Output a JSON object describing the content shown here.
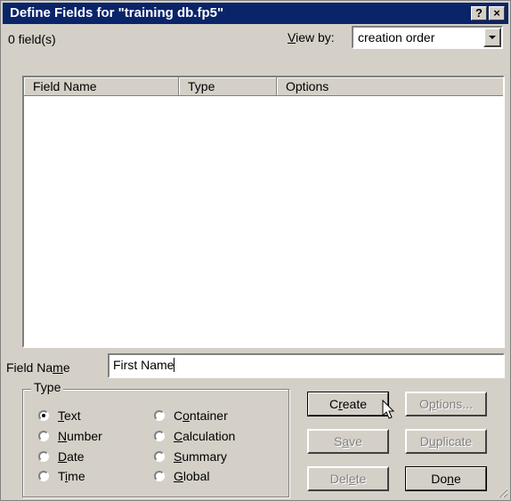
{
  "window": {
    "title": "Define Fields for \"training db.fp5\"",
    "help_button": "?",
    "close_button": "×"
  },
  "field_count": "0 field(s)",
  "view_by": {
    "label_mnemonic": "V",
    "label_rest": "iew by:",
    "value": "creation order"
  },
  "table": {
    "columns": [
      "Field Name",
      "Type",
      "Options"
    ],
    "rows": []
  },
  "field_name": {
    "label_pre": "Field Na",
    "label_mnemonic": "m",
    "label_post": "e",
    "value": "First Name"
  },
  "type_group": {
    "label": "Type",
    "options": [
      {
        "mnemonic": "T",
        "rest": "ext",
        "selected": true
      },
      {
        "mnemonic": "N",
        "rest": "umber",
        "selected": false
      },
      {
        "mnemonic": "D",
        "rest": "ate",
        "selected": false
      },
      {
        "pre": "T",
        "mnemonic": "i",
        "rest": "me",
        "selected": false
      },
      {
        "pre": "C",
        "mnemonic": "o",
        "rest": "ntainer",
        "selected": false
      },
      {
        "mnemonic": "C",
        "rest": "alculation",
        "selected": false
      },
      {
        "mnemonic": "S",
        "rest": "ummary",
        "selected": false
      },
      {
        "mnemonic": "G",
        "rest": "lobal",
        "selected": false
      }
    ]
  },
  "buttons": {
    "create": {
      "pre": "C",
      "mnemonic": "r",
      "post": "eate",
      "enabled": true
    },
    "options": {
      "pre": "O",
      "mnemonic": "p",
      "post": "tions...",
      "enabled": false
    },
    "save": {
      "pre": "S",
      "mnemonic": "a",
      "post": "ve",
      "enabled": false
    },
    "duplicate": {
      "pre": "D",
      "mnemonic": "u",
      "post": "plicate",
      "enabled": false
    },
    "delete": {
      "pre": "Del",
      "mnemonic": "e",
      "post": "te",
      "enabled": false
    },
    "done": {
      "pre": "Do",
      "mnemonic": "n",
      "post": "e",
      "enabled": true
    }
  },
  "icons": [
    "question-icon",
    "close-icon",
    "dropdown-arrow-icon",
    "mouse-pointer-icon",
    "size-grip-icon"
  ]
}
